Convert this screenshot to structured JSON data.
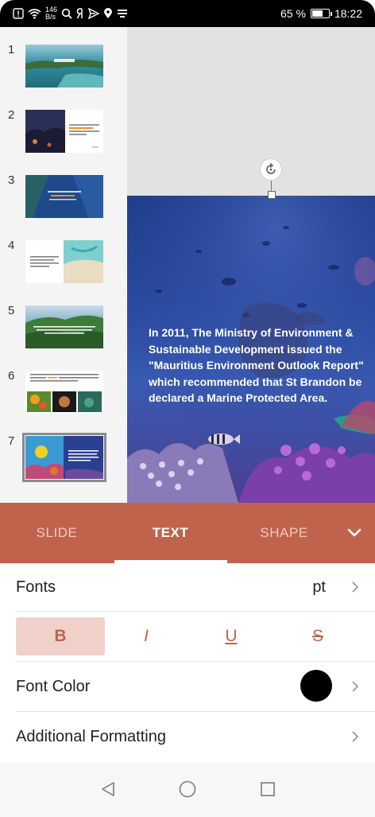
{
  "status_bar": {
    "net_speed_value": "146",
    "net_speed_unit": "B/s",
    "battery_text": "65 %",
    "battery_level": 0.65,
    "time": "18:22"
  },
  "thumbnails": [
    {
      "number": "1"
    },
    {
      "number": "2"
    },
    {
      "number": "3"
    },
    {
      "number": "4"
    },
    {
      "number": "5"
    },
    {
      "number": "6"
    },
    {
      "number": "7",
      "selected": true
    }
  ],
  "slide": {
    "text_lines": [
      "In 2011, The Ministry of Environment &",
      "Sustainable Development issued the",
      "\"Mauritius Environment Outlook Report\"",
      "which recommended that St Brandon be",
      "declared a Marine Protected Area."
    ]
  },
  "tabs": {
    "slide": "SLIDE",
    "text": "TEXT",
    "shape": "SHAPE",
    "active": "TEXT"
  },
  "panel": {
    "fonts_label": "Fonts",
    "fonts_value": "pt",
    "bold": "B",
    "italic": "I",
    "underline": "U",
    "strike": "S",
    "font_color_label": "Font Color",
    "font_color_value": "#000000",
    "additional_label": "Additional Formatting"
  },
  "colors": {
    "accent": "#c0634d",
    "accent_light": "#f0d1c9"
  }
}
